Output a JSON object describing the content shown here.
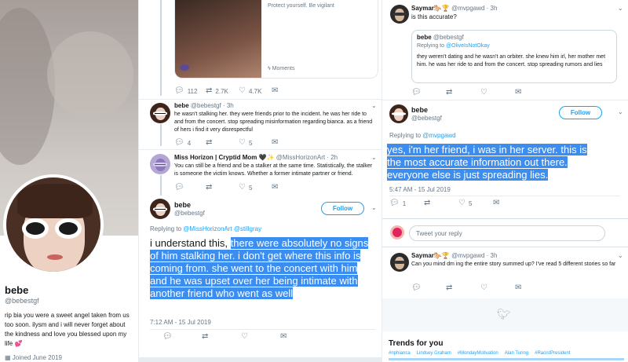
{
  "profile": {
    "name": "bebe",
    "handle": "@bebestgf",
    "bio": "rip bia you were a sweet angel taken from us too soon. ilysm and i will never forget about the kindness and love you blessed upon my life",
    "bio_emoji": "💕",
    "joined": "Joined June 2019"
  },
  "image_card": {
    "caption": "Protect yourself. Be vigilant",
    "moments_label": "Moments",
    "replies": "112",
    "retweets": "2.7K",
    "likes": "4.7K"
  },
  "mid_tweet1": {
    "name": "bebe",
    "handle": "@bebestgf",
    "time": "· 3h",
    "text": "he wasn't stalking her. they were friends prior to the incident. he was her ride to and from the concert. stop spreading misinformation regarding bianca. as a friend of hers i find it very disrespectful",
    "replies": "4",
    "retweets": "",
    "likes": "5"
  },
  "mid_tweet2": {
    "name": "Miss Horizon | Cryptid Mom",
    "name_emoji": "🖤✨",
    "handle": "@MissHorizonArt",
    "time": "· 2h",
    "text": "You can still be a friend and be a stalker at the same time. Statistically, the stalker is someone the victim knows. Whether a former intimate partner or friend.",
    "replies": "",
    "retweets": "",
    "likes": "5"
  },
  "mid_tweet3": {
    "name": "bebe",
    "handle": "@bebestgf",
    "follow_label": "Follow",
    "replying_prefix": "Replying to",
    "replying_to": "@MissHorizonArt @stillgray",
    "text_plain": "i understand this, ",
    "text_highlight": "there were absolutely no signs of him stalking her. i don't get where this info is coming from. she went to the concert with him and he was upset over her being intimate with another friend who went as well",
    "timestamp": "7:12 AM - 15 Jul 2019"
  },
  "right_tweet1": {
    "name": "Saymar",
    "name_emoji": "🐎🏆",
    "handle": "@mvpgawd",
    "time": "· 3h",
    "text": "is this accurate?"
  },
  "quoted": {
    "name": "bebe",
    "handle": "@bebestgf",
    "replying_prefix": "Replying to",
    "replying_to": "@OliveIsNotOkay",
    "text": "they weren't dating and he wasn't an orbiter. she knew him irl, her mother met him. he was her ride to and from the concert. stop spreading rumors and lies"
  },
  "right_tweet2": {
    "name": "bebe",
    "handle": "@bebestgf",
    "follow_label": "Follow",
    "replying_prefix": "Replying to",
    "replying_to": "@mvpgawd",
    "text": "yes, i'm her friend, i was in her server. this is the most accurate information out there. everyone else is just spreading lies.",
    "timestamp": "5:47 AM - 15 Jul 2019",
    "replies": "1",
    "retweets": "",
    "likes": "5"
  },
  "reply_box": {
    "placeholder": "Tweet your reply"
  },
  "right_tweet3": {
    "name": "Saymar",
    "name_emoji": "🐎🏆",
    "handle": "@mvpgawd",
    "time": "· 3h",
    "text": "Can you mind dm ing the entire story summed up? I've read 5 different stories so far"
  },
  "trends": {
    "title": "Trends for you",
    "items": [
      "#nphianca",
      "Lindsey Graham",
      "#MondayMotivation",
      "Alan Turing",
      "#RacistPresident"
    ]
  },
  "colors": {
    "accent": "#1da1f2",
    "highlight": "#3c8df0",
    "heart": "#e0245e"
  }
}
